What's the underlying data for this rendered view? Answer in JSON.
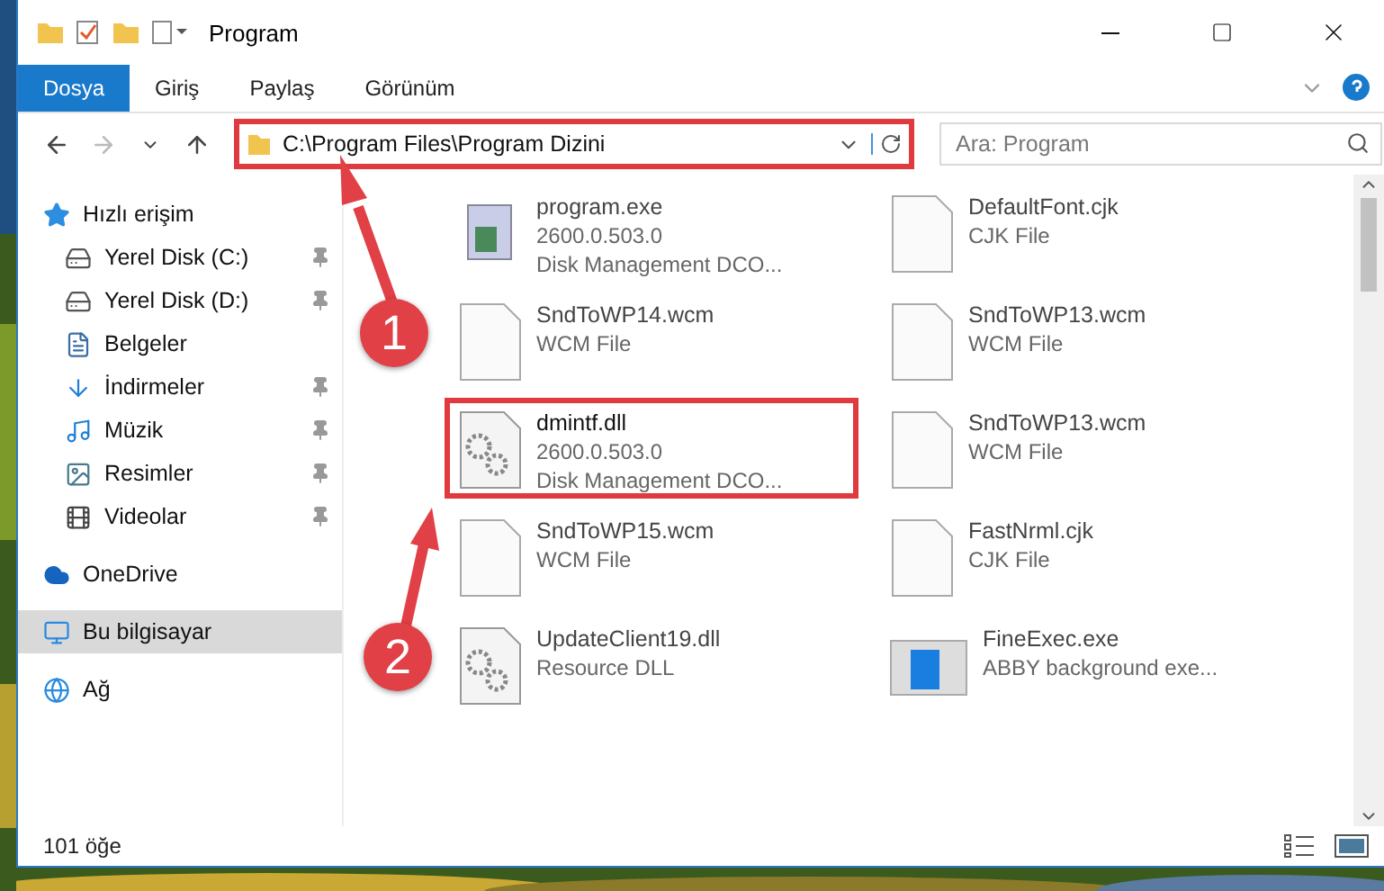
{
  "window": {
    "title": "Program"
  },
  "ribbon": {
    "tabs": [
      {
        "label": "Dosya",
        "selected": true
      },
      {
        "label": "Giriş",
        "selected": false
      },
      {
        "label": "Paylaş",
        "selected": false
      },
      {
        "label": "Görünüm",
        "selected": false
      }
    ]
  },
  "address": {
    "path": "C:\\Program Files\\Program Dizini",
    "highlighted": true
  },
  "search": {
    "placeholder": "Ara: Program"
  },
  "sidebar": {
    "items": [
      {
        "label": "Hızlı erişim",
        "kind": "star",
        "selected": false,
        "children": [
          {
            "label": "Yerel Disk (C:)",
            "kind": "drive",
            "selected": false,
            "pinned": true
          },
          {
            "label": "Yerel Disk (D:)",
            "kind": "drive",
            "selected": false,
            "pinned": true
          },
          {
            "label": "Belgeler",
            "kind": "document",
            "selected": false,
            "pinned": false
          },
          {
            "label": "İndirmeler",
            "kind": "download",
            "selected": false,
            "pinned": true
          },
          {
            "label": "Müzik",
            "kind": "music",
            "selected": false,
            "pinned": true
          },
          {
            "label": "Resimler",
            "kind": "picture",
            "selected": false,
            "pinned": true
          },
          {
            "label": "Videolar",
            "kind": "video",
            "selected": false,
            "pinned": true
          }
        ]
      },
      {
        "label": "OneDrive",
        "kind": "cloud",
        "selected": false
      },
      {
        "label": "Bu bilgisayar",
        "kind": "computer",
        "selected": true
      },
      {
        "label": "Ağ",
        "kind": "network",
        "selected": false
      }
    ]
  },
  "files": [
    {
      "name": "program.exe",
      "details": [
        "2600.0.503.0",
        "Disk Management DCO..."
      ],
      "kind": "exe",
      "highlighted": false
    },
    {
      "name": "DefaultFont.cjk",
      "details": [
        "CJK File"
      ],
      "kind": "blank",
      "highlighted": false
    },
    {
      "name": "SndToWP14.wcm",
      "details": [
        "WCM File"
      ],
      "kind": "blank",
      "highlighted": false
    },
    {
      "name": "SndToWP13.wcm",
      "details": [
        "WCM File"
      ],
      "kind": "blank",
      "highlighted": false
    },
    {
      "name": "dmintf.dll",
      "details": [
        "2600.0.503.0",
        "Disk Management DCO..."
      ],
      "kind": "dll",
      "highlighted": true
    },
    {
      "name": "SndToWP13.wcm",
      "details": [
        "WCM File"
      ],
      "kind": "blank",
      "highlighted": false
    },
    {
      "name": "SndToWP15.wcm",
      "details": [
        "WCM File"
      ],
      "kind": "blank",
      "highlighted": false
    },
    {
      "name": "FastNrml.cjk",
      "details": [
        "CJK File"
      ],
      "kind": "blank",
      "highlighted": false
    },
    {
      "name": "UpdateClient19.dll",
      "details": [
        "Resource DLL"
      ],
      "kind": "dll",
      "highlighted": false
    },
    {
      "name": "FineExec.exe",
      "details": [
        "ABBY background exe..."
      ],
      "kind": "app",
      "highlighted": false
    }
  ],
  "status_bar": {
    "count": "101 öğe"
  },
  "annotations": [
    {
      "label": "1"
    },
    {
      "label": "2"
    }
  ]
}
